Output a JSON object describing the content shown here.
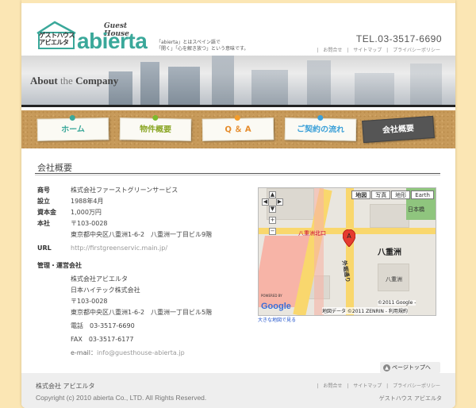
{
  "header": {
    "logo_kana_line1": "ゲストハウス",
    "logo_kana_line2": "アビエルタ",
    "logo_guest_house": "Guest House",
    "logo_word": "abierta",
    "tagline_line1": "「abierta」とはスペイン語で",
    "tagline_line2": "「開く」「心を解き放つ」という意味です。",
    "tel": "TEL.03-3517-6690",
    "utility_links": [
      "お問合せ",
      "サイトマップ",
      "プライバシーポリシー"
    ]
  },
  "banner": {
    "title_a": "About",
    "title_b": " the ",
    "title_c": "Company"
  },
  "nav": {
    "items": [
      {
        "label": "ホーム",
        "color": "#3aa89a",
        "pin": "#3aa89a"
      },
      {
        "label": "物件概要",
        "color": "#8aa624",
        "pin": "#7bbb2d"
      },
      {
        "label": "Q ＆ A",
        "color": "#e58b2b",
        "pin": "#f39c2b"
      },
      {
        "label": "ご契約の流れ",
        "color": "#3ba0d8",
        "pin": "#3ba0d8"
      },
      {
        "label": "会社概要",
        "color": "#ffffff",
        "pin": "#888888"
      }
    ]
  },
  "content": {
    "title": "会社概要",
    "rows": [
      {
        "key": "商号",
        "value": "株式会社ファーストグリーンサービス"
      },
      {
        "key": "設立",
        "value": "1988年4月"
      },
      {
        "key": "資本金",
        "value": "1,000万円"
      },
      {
        "key": "本社",
        "value": "〒103-0028"
      }
    ],
    "hq_address": "東京都中央区八重洲1-6-2　八重洲一丁目ビル9階",
    "url_key": "URL",
    "url_value": "http://firstgreenservic.main.jp/",
    "mgmt_key": "管理・運営会社",
    "mgmt_lines": [
      "株式会社アビエルタ",
      "日本ハイテック株式会社",
      "〒103-0028",
      "東京都中央区八重洲1-6-2　八重洲一丁目ビル5階"
    ],
    "phone": "電話　03-3517-6690",
    "fax": "FAX　03-3517-6177",
    "email_label": "e-mail：",
    "email_value": "info@guesthouse-abierta.jp"
  },
  "map": {
    "buttons": [
      "地図",
      "写真",
      "地形",
      "Earth"
    ],
    "label_yaesu": "八重洲",
    "label_station_north": "八重洲北口",
    "label_sotobori": "外堀通り",
    "label_nihonbashi": "日本橋",
    "label_yaesu_sub": "八重洲",
    "label_marker": "A",
    "label_google": "Google",
    "label_powered": "POWERED BY",
    "copyright": "地図データ ©2011 ZENRIN - 利用規約",
    "copyright2": "©2011 Google -",
    "larger_link": "大きな地図で見る"
  },
  "pagetop": {
    "label": "ページトップへ"
  },
  "footer": {
    "company": "株式会社 アビエルタ",
    "copyright": "Copyright (c) 2010 abierta Co., LTD. All Rights Reserved.",
    "links": [
      "お問合せ",
      "サイトマップ",
      "プライバシーポリシー"
    ],
    "site_name": "ゲストハウス アビエルタ"
  }
}
